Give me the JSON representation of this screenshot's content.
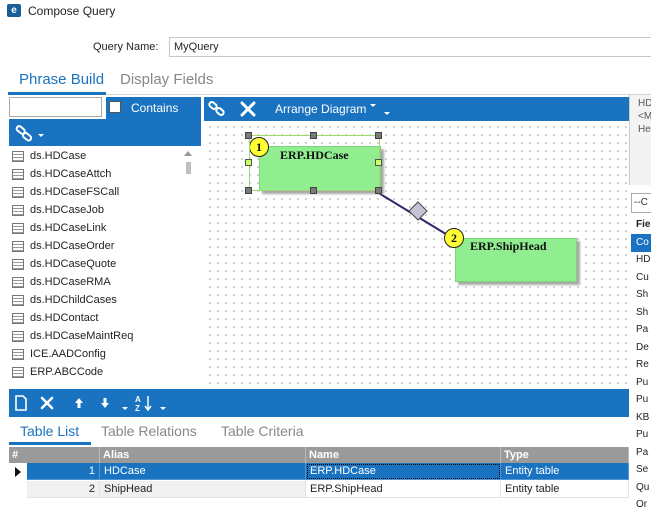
{
  "window": {
    "title": "Compose Query",
    "app_icon_letter": "e"
  },
  "query_name": {
    "label": "Query Name:",
    "value": "MyQuery"
  },
  "top_tabs": [
    {
      "label": "Phrase Build",
      "active": true
    },
    {
      "label": "Display Fields",
      "active": false
    }
  ],
  "left_panel": {
    "search_value": "",
    "contains_label": "Contains",
    "tables": [
      "ds.HDCase",
      "ds.HDCaseAttch",
      "ds.HDCaseFSCall",
      "ds.HDCaseJob",
      "ds.HDCaseLink",
      "ds.HDCaseOrder",
      "ds.HDCaseQuote",
      "ds.HDCaseRMA",
      "ds.HDChildCases",
      "ds.HDContact",
      "ds.HDCaseMaintReq",
      "ICE.AADConfig",
      "ERP.ABCCode"
    ]
  },
  "diagram": {
    "toolbar": {
      "arrange_label": "Arrange Diagram"
    },
    "entities": [
      {
        "number": "1",
        "name": "ERP.HDCase",
        "selected": true
      },
      {
        "number": "2",
        "name": "ERP.ShipHead",
        "selected": false
      }
    ]
  },
  "right_panel": {
    "text_lines": [
      "HD",
      "<M",
      "He"
    ],
    "dropdown_value": "--C",
    "fields_header": "Fie",
    "fields": [
      "Co",
      "HD",
      "Cu",
      "Sh",
      "Sh",
      "Pa",
      "De",
      "Re",
      "Pu",
      "Pu",
      "KB",
      "Pu",
      "Pa",
      "Se",
      "Qu",
      "Or"
    ],
    "selected_field_index": 0
  },
  "bottom_tabs": [
    {
      "label": "Table List",
      "active": true
    },
    {
      "label": "Table Relations",
      "active": false
    },
    {
      "label": "Table Criteria",
      "active": false
    }
  ],
  "table_grid": {
    "columns": [
      "#",
      "Alias",
      "Name",
      "Type"
    ],
    "rows": [
      {
        "num": "1",
        "alias": "HDCase",
        "name": "ERP.HDCase",
        "type": "Entity table",
        "selected": true
      },
      {
        "num": "2",
        "alias": "ShipHead",
        "name": "ERP.ShipHead",
        "type": "Entity table",
        "selected": false
      }
    ]
  },
  "colors": {
    "accent": "#1a73c0",
    "entity_fill": "#90ee90",
    "badge_fill": "#ffff33",
    "grid_header": "#9a9a9a"
  },
  "icons": [
    "app-logo-icon",
    "link-icon",
    "delete-x-icon",
    "new-doc-icon",
    "arrow-up-icon",
    "arrow-down-icon",
    "sort-az-icon",
    "table-icon"
  ]
}
